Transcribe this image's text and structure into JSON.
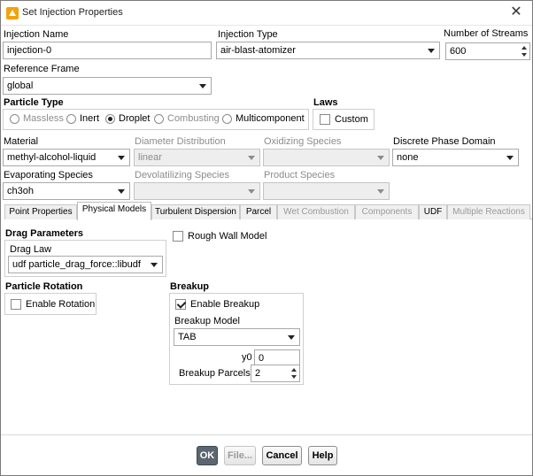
{
  "window": {
    "title": "Set Injection Properties"
  },
  "top": {
    "injection_name_label": "Injection Name",
    "injection_name_value": "injection-0",
    "injection_type_label": "Injection Type",
    "injection_type_value": "air-blast-atomizer",
    "number_of_streams_label": "Number of Streams",
    "number_of_streams_value": "600",
    "reference_frame_label": "Reference Frame",
    "reference_frame_value": "global"
  },
  "particle_type": {
    "label": "Particle Type",
    "options": [
      "Massless",
      "Inert",
      "Droplet",
      "Combusting",
      "Multicomponent"
    ],
    "selected": "Droplet"
  },
  "laws": {
    "label": "Laws",
    "custom_label": "Custom",
    "custom_checked": false
  },
  "material": {
    "material_label": "Material",
    "material_value": "methyl-alcohol-liquid",
    "diameter_distribution_label": "Diameter Distribution",
    "diameter_distribution_value": "linear",
    "oxidizing_species_label": "Oxidizing Species",
    "oxidizing_species_value": "",
    "discrete_phase_domain_label": "Discrete Phase Domain",
    "discrete_phase_domain_value": "none",
    "evaporating_species_label": "Evaporating Species",
    "evaporating_species_value": "ch3oh",
    "devolatilizing_species_label": "Devolatilizing Species",
    "devolatilizing_species_value": "",
    "product_species_label": "Product Species",
    "product_species_value": ""
  },
  "tabs": [
    {
      "label": "Point Properties",
      "enabled": true
    },
    {
      "label": "Physical Models",
      "enabled": true,
      "active": true
    },
    {
      "label": "Turbulent Dispersion",
      "enabled": true
    },
    {
      "label": "Parcel",
      "enabled": true
    },
    {
      "label": "Wet Combustion",
      "enabled": false
    },
    {
      "label": "Components",
      "enabled": false
    },
    {
      "label": "UDF",
      "enabled": true
    },
    {
      "label": "Multiple Reactions",
      "enabled": false
    }
  ],
  "physical_models": {
    "drag_parameters_label": "Drag Parameters",
    "drag_law_label": "Drag Law",
    "drag_law_value": "udf particle_drag_force::libudf",
    "rough_wall_label": "Rough Wall Model",
    "rough_wall_checked": false,
    "particle_rotation_label": "Particle Rotation",
    "enable_rotation_label": "Enable Rotation",
    "enable_rotation_checked": false,
    "breakup_label": "Breakup",
    "enable_breakup_label": "Enable Breakup",
    "enable_breakup_checked": true,
    "breakup_model_label": "Breakup Model",
    "breakup_model_value": "TAB",
    "y0_label": "y0",
    "y0_value": "0",
    "breakup_parcels_label": "Breakup Parcels",
    "breakup_parcels_value": "2"
  },
  "buttons": {
    "ok": "OK",
    "file": "File...",
    "cancel": "Cancel",
    "help": "Help"
  },
  "colors": {
    "primary_button": "#5c6670",
    "disabled_text": "#8c8c8c"
  }
}
